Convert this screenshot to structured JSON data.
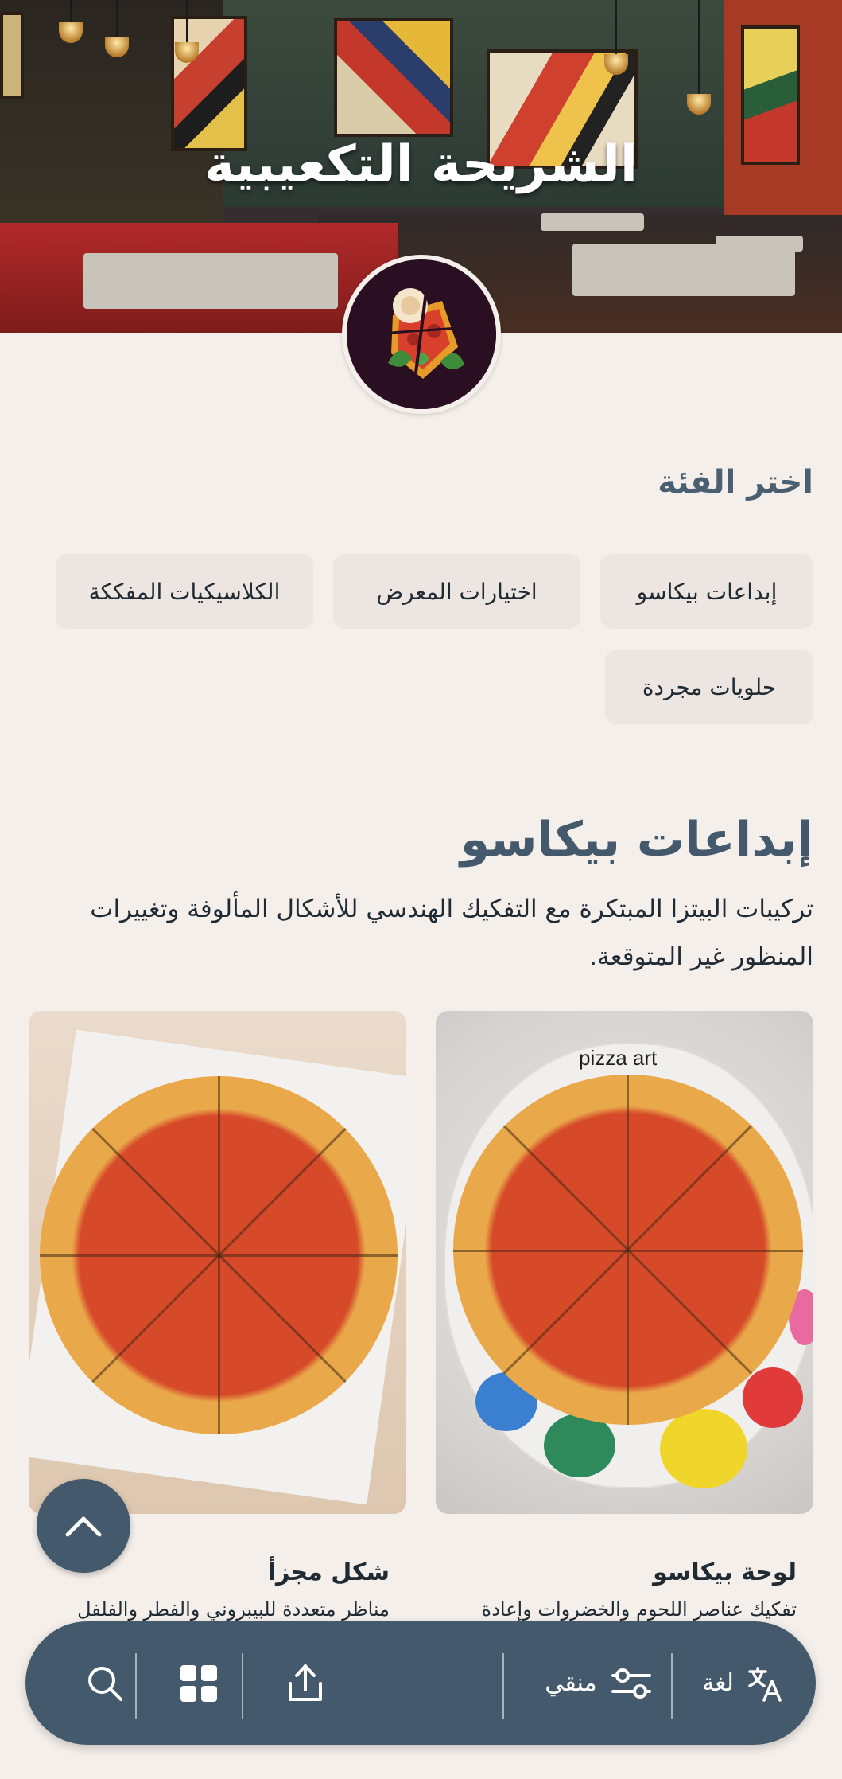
{
  "restaurant": {
    "name": "الشريحة التكعيبية"
  },
  "categories": {
    "heading": "اختر الفئة",
    "items": [
      {
        "label": "إبداعات بيكاسو"
      },
      {
        "label": "اختيارات المعرض"
      },
      {
        "label": "الكلاسيكيات المفككة"
      },
      {
        "label": "حلويات مجردة"
      }
    ]
  },
  "current_category": {
    "title": "إبداعات بيكاسو",
    "description": "تركيبات البيتزا المبتكرة مع التفكيك الهندسي للأشكال المألوفة وتغييرات المنظور غير المتوقعة."
  },
  "products": [
    {
      "name": "لوحة بيكاسو",
      "description": "تفكيك عناصر اللحوم والخضروات وإعادة",
      "image_text": "pizza art"
    },
    {
      "name": "شكل مجزأ",
      "description": "مناظر متعددة للبيبروني والفطر والفلفل"
    }
  ],
  "bottom_bar": {
    "language_label": "لغة",
    "filter_label": "منقي",
    "share_icon": "share-icon",
    "grid_icon": "grid-icon",
    "search_icon": "search-icon"
  },
  "colors": {
    "accent": "#44596b",
    "background": "#f5efeb",
    "chip": "#ece5e1"
  }
}
